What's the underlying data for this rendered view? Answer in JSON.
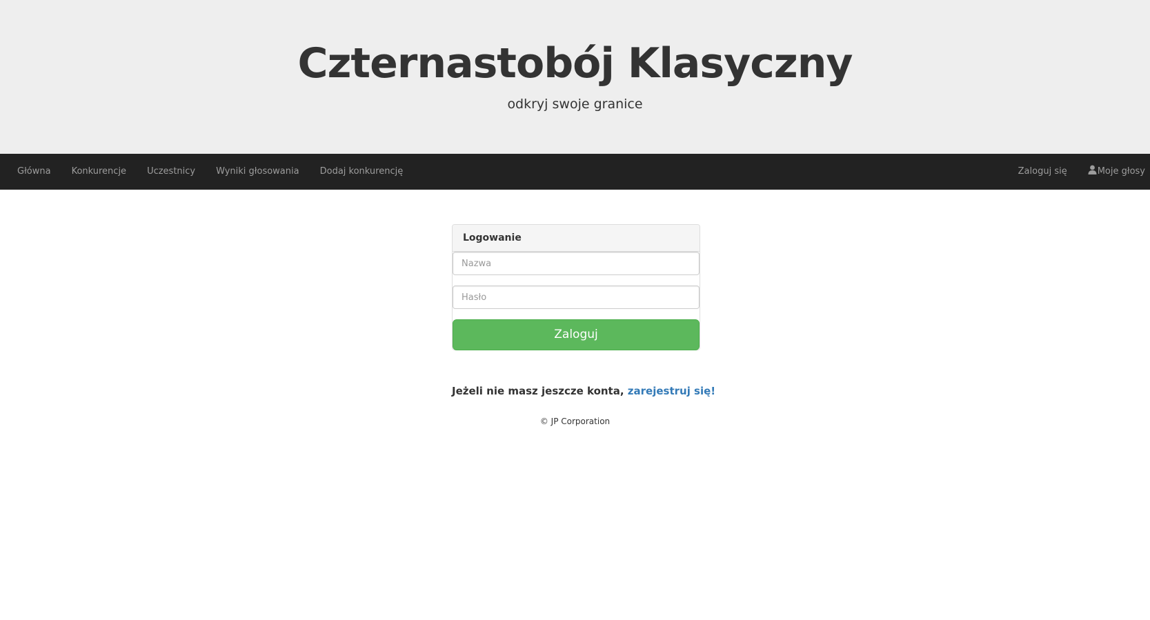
{
  "header": {
    "title": "Czternastobój Klasyczny",
    "subtitle": "odkryj swoje granice"
  },
  "navbar": {
    "left_items": [
      "Główna",
      "Konkurencje",
      "Uczestnicy",
      "Wyniki głosowania",
      "Dodaj konkurencję"
    ],
    "login_label": "Zaloguj się",
    "my_votes_label": "Moje głosy",
    "my_votes_icon": "user-icon"
  },
  "login_panel": {
    "heading": "Logowanie",
    "name_placeholder": "Nazwa",
    "password_placeholder": "Hasło",
    "submit_label": "Zaloguj",
    "submit_color": "#5cb85c"
  },
  "register": {
    "prompt": "Jeżeli nie masz jeszcze konta, ",
    "link_label": "zarejestruj się!",
    "link_color": "#337ab7"
  },
  "footer": {
    "copyright": "© JP Corporation"
  }
}
